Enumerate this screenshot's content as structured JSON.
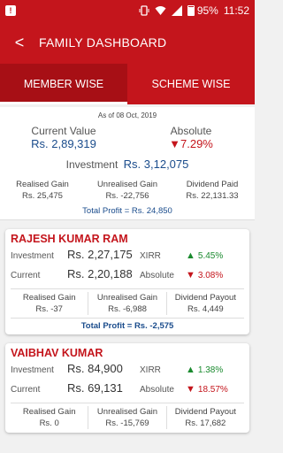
{
  "status": {
    "notif": "!",
    "battery": "95%",
    "time": "11:52"
  },
  "appbar": {
    "back": "<",
    "title": "FAMILY DASHBOARD"
  },
  "tabs": [
    {
      "label": "MEMBER WISE"
    },
    {
      "label": "SCHEME WISE"
    }
  ],
  "summary": {
    "as_of": "As of 08 Oct, 2019",
    "current_value_label": "Current Value",
    "current_value": "Rs. 2,89,319",
    "absolute_label": "Absolute",
    "absolute": "7.29%",
    "investment_label": "Investment",
    "investment": "Rs. 3,12,075",
    "gains": [
      {
        "label": "Realised Gain",
        "value": "Rs. 25,475"
      },
      {
        "label": "Unrealised Gain",
        "value": "Rs. -22,756"
      },
      {
        "label": "Dividend Paid",
        "value": "Rs. 22,131.33"
      }
    ],
    "total_profit": "Total Profit = Rs. 24,850"
  },
  "labels": {
    "investment": "Investment",
    "current": "Current",
    "xirr": "XIRR",
    "absolute": "Absolute"
  },
  "members": [
    {
      "name": "RAJESH KUMAR RAM",
      "investment": "Rs. 2,27,175",
      "xirr": "5.45%",
      "current": "Rs. 2,20,188",
      "absolute": "3.08%",
      "gains": [
        {
          "label": "Realised Gain",
          "value": "Rs. -37"
        },
        {
          "label": "Unrealised Gain",
          "value": "Rs. -6,988"
        },
        {
          "label": "Dividend Payout",
          "value": "Rs. 4,449"
        }
      ],
      "total_profit": "Total Profit = Rs. -2,575"
    },
    {
      "name": "VAIBHAV KUMAR",
      "investment": "Rs. 84,900",
      "xirr": "1.38%",
      "current": "Rs. 69,131",
      "absolute": "18.57%",
      "gains": [
        {
          "label": "Realised Gain",
          "value": "Rs. 0"
        },
        {
          "label": "Unrealised Gain",
          "value": "Rs. -15,769"
        },
        {
          "label": "Dividend Payout",
          "value": "Rs. 17,682"
        }
      ]
    }
  ],
  "colors": {
    "primary": "#c4151c",
    "tab_active": "#a70f15",
    "value_blue": "#1a4c8c",
    "up_green": "#1a8a2e"
  }
}
